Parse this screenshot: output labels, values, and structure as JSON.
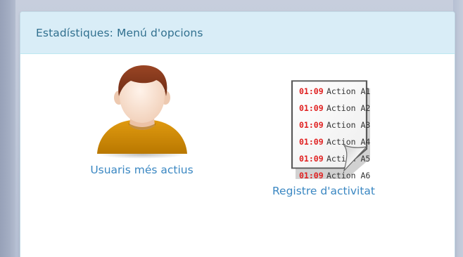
{
  "panel": {
    "title": "Estadístiques: Menú d'opcions"
  },
  "options": [
    {
      "label": "Usuaris més actius",
      "icon": "user-avatar-icon"
    },
    {
      "label": "Registre d'activitat",
      "icon": "activity-log-document-icon",
      "log_entries": [
        {
          "time": "01:09",
          "action": "Action A1"
        },
        {
          "time": "01:09",
          "action": "Action A2"
        },
        {
          "time": "01:09",
          "action": "Action A3"
        },
        {
          "time": "01:09",
          "action": "Action A4"
        },
        {
          "time": "01:09",
          "action": "Action A5"
        },
        {
          "time": "01:09",
          "action": "Action A6"
        }
      ]
    }
  ],
  "colors": {
    "header_bg": "#d9edf7",
    "header_text": "#31708f",
    "link": "#3a87c2",
    "log_time": "#e02020",
    "shirt": "#d08a00",
    "hair": "#8b3a1d"
  }
}
